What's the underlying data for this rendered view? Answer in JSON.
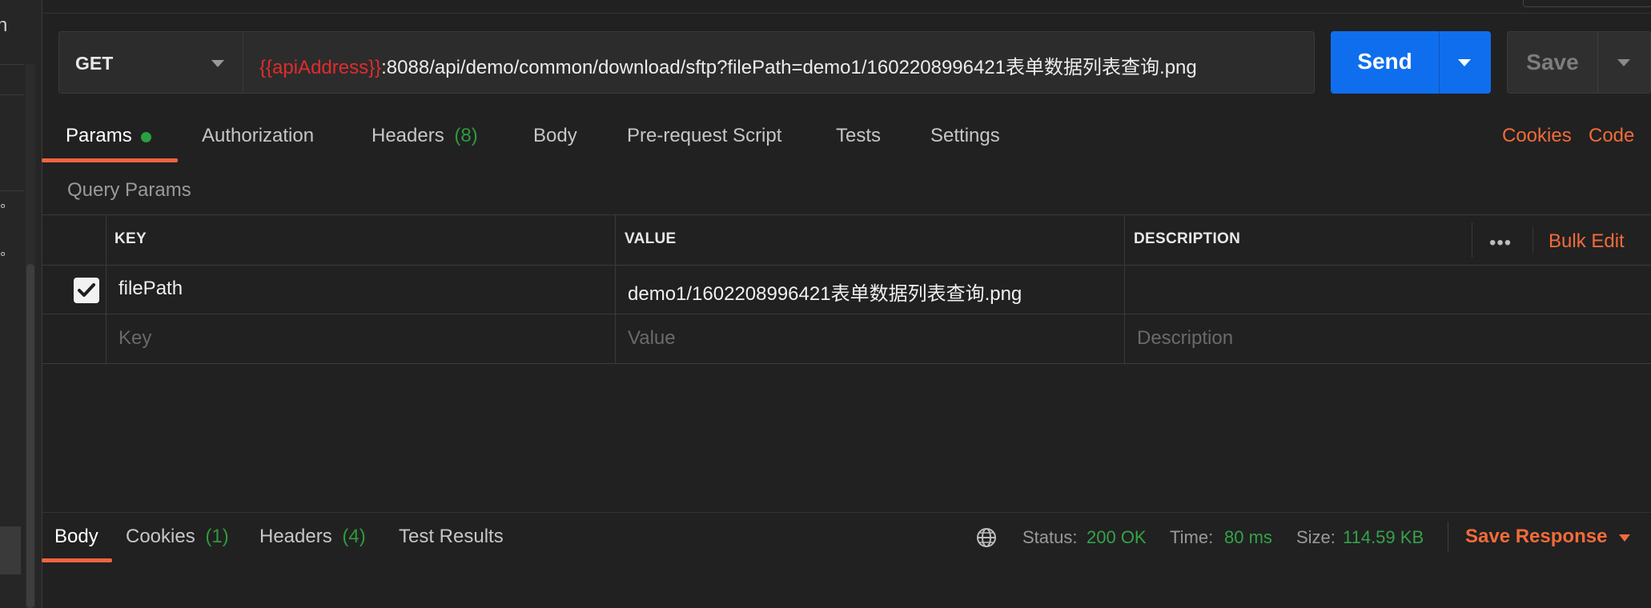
{
  "sidebar": {
    "glyphs": [
      "n",
      "°",
      "°"
    ]
  },
  "request": {
    "method": "GET",
    "url_variable": "{{apiAddress}}",
    "url_rest": ":8088/api/demo/common/download/sftp?filePath=demo1/1602208996421表单数据列表查询.png",
    "send_label": "Send",
    "save_label": "Save"
  },
  "tabs": [
    {
      "label": "Params"
    },
    {
      "label": "Authorization"
    },
    {
      "label": "Headers",
      "count": "(8)"
    },
    {
      "label": "Body"
    },
    {
      "label": "Pre-request Script"
    },
    {
      "label": "Tests"
    },
    {
      "label": "Settings"
    }
  ],
  "links": {
    "cookies": "Cookies",
    "code": "Code"
  },
  "query_params": {
    "title": "Query Params",
    "columns": [
      "KEY",
      "VALUE",
      "DESCRIPTION"
    ],
    "more": "•••",
    "bulk_edit": "Bulk Edit",
    "rows": [
      {
        "checked": true,
        "key": "filePath",
        "value": "demo1/1602208996421表单数据列表查询.png",
        "description": ""
      }
    ],
    "placeholders": {
      "key": "Key",
      "value": "Value",
      "description": "Description"
    }
  },
  "response": {
    "tabs": [
      {
        "label": "Body"
      },
      {
        "label": "Cookies",
        "count": "(1)"
      },
      {
        "label": "Headers",
        "count": "(4)"
      },
      {
        "label": "Test Results"
      }
    ],
    "status_label": "Status:",
    "status_value": "200 OK",
    "time_label": "Time:",
    "time_value": "80 ms",
    "size_label": "Size:",
    "size_value": "114.59 KB",
    "save_response": "Save Response"
  },
  "icons": {
    "globe": "globe-icon",
    "checkmark": "checkmark-icon",
    "caret": "caret-down-icon"
  },
  "colors": {
    "send": "#0f6eee",
    "accent": "#f26b3a",
    "ok_green": "#33a34a",
    "url_variable": "#e02c2c"
  }
}
